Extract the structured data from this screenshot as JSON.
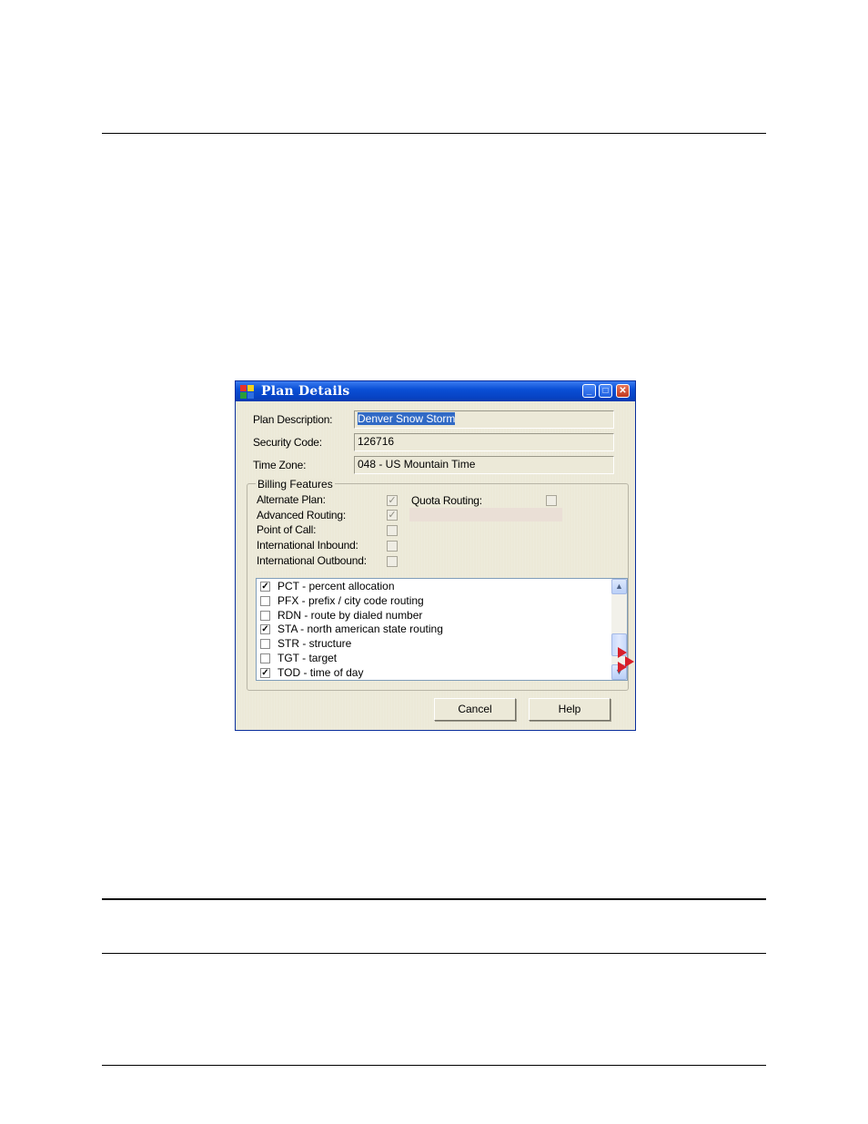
{
  "window": {
    "title": "Plan Details",
    "controls": {
      "minimize": "_",
      "maximize": "□",
      "close": "✕"
    },
    "icon": "app-window-icon",
    "icon_colors": [
      "#e8322a",
      "#f6d21b",
      "#2a9d3a",
      "#2e6fe0"
    ]
  },
  "form": {
    "plan_description_label": "Plan Description:",
    "plan_description_value": "Denver Snow Storm",
    "security_code_label": "Security Code:",
    "security_code_value": "126716",
    "time_zone_label": "Time Zone:",
    "time_zone_value": "048 - US Mountain Time"
  },
  "billing": {
    "caption": "Billing Features",
    "alternate_plan_label": "Alternate Plan:",
    "alternate_plan_checked": "✓",
    "advanced_routing_label": "Advanced Routing:",
    "advanced_routing_checked": "✓",
    "point_of_call_label": "Point of Call:",
    "point_of_call_checked": "",
    "international_inbound_label": "International Inbound:",
    "international_inbound_checked": "",
    "international_outbound_label": "International Outbound:",
    "international_outbound_checked": "",
    "quota_routing_label": "Quota Routing:",
    "quota_routing_checked": ""
  },
  "features": [
    {
      "label": "PCT - percent allocation",
      "mark": "✓"
    },
    {
      "label": "PFX - prefix / city code routing",
      "mark": ""
    },
    {
      "label": "RDN - route by dialed number",
      "mark": ""
    },
    {
      "label": "STA - north american state routing",
      "mark": "✓"
    },
    {
      "label": "STR - structure",
      "mark": ""
    },
    {
      "label": "TGT - target",
      "mark": ""
    },
    {
      "label": "TOD - time of day",
      "mark": "✓"
    }
  ],
  "scrollbar": {
    "up": "▲",
    "down": "▼"
  },
  "buttons": {
    "cancel": "Cancel",
    "help": "Help"
  },
  "colors": {
    "title_bar": "#0a4fd6",
    "dialog_bg": "#ece9d8",
    "selection": "#316ac5"
  }
}
